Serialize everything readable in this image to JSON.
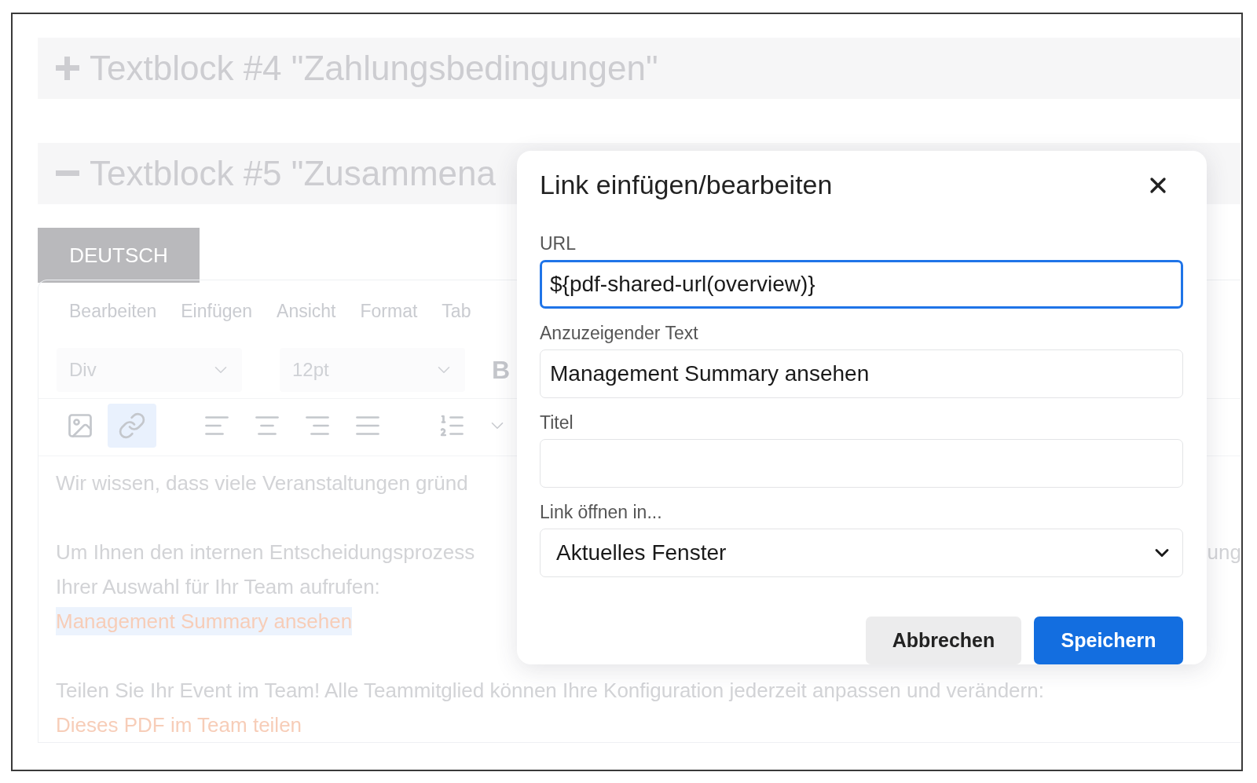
{
  "sections": [
    {
      "title": "Textblock #4 \"Zahlungsbedingungen\"",
      "expanded": false
    },
    {
      "title": "Textblock #5 \"Zusammena",
      "expanded": true
    }
  ],
  "language_tabs": [
    {
      "label": "DEUTSCH",
      "selected": true
    }
  ],
  "editor": {
    "menu": [
      "Bearbeiten",
      "Einfügen",
      "Ansicht",
      "Format",
      "Tab"
    ],
    "block_format": "Div",
    "font_size": "12pt",
    "bold_label": "B",
    "tools": [
      {
        "kind": "image",
        "active": false
      },
      {
        "kind": "link",
        "active": true
      },
      {
        "kind": "align-left",
        "active": false
      },
      {
        "kind": "align-center",
        "active": false
      },
      {
        "kind": "align-right",
        "active": false
      },
      {
        "kind": "justify",
        "active": false
      },
      {
        "kind": "numbered-list",
        "active": false
      }
    ],
    "paragraphs": [
      [
        {
          "kind": "text",
          "text": "Wir wissen, dass viele Veranstaltungen gründ"
        }
      ],
      [
        {
          "kind": "text",
          "text": "Um Ihnen den internen Entscheidungsprozess",
          "trailing": "ung"
        },
        {
          "kind": "text",
          "text": "Ihrer Auswahl für Ihr Team aufrufen:"
        },
        {
          "kind": "link",
          "text": "Management Summary ansehen",
          "selected": true
        }
      ],
      [
        {
          "kind": "text",
          "text": "Teilen Sie Ihr Event im Team! Alle Teammitglied können Ihre Konfiguration jederzeit anpassen und verändern:"
        },
        {
          "kind": "link",
          "text": "Dieses PDF im Team teilen",
          "selected": false
        }
      ]
    ]
  },
  "dialog": {
    "title": "Link einfügen/bearbeiten",
    "fields": [
      {
        "kind": "input",
        "label": "URL",
        "value": "${pdf-shared-url(overview)}",
        "focused": true
      },
      {
        "kind": "input",
        "label": "Anzuzeigender Text",
        "value": "Management Summary ansehen",
        "focused": false
      },
      {
        "kind": "input",
        "label": "Titel",
        "focused": false
      },
      {
        "kind": "select",
        "label": "Link öffnen in...",
        "value": "Aktuelles Fenster",
        "focused": false
      }
    ],
    "buttons": [
      {
        "label": "Abbrechen",
        "kind": "secondary"
      },
      {
        "label": "Speichern",
        "kind": "primary"
      }
    ]
  }
}
